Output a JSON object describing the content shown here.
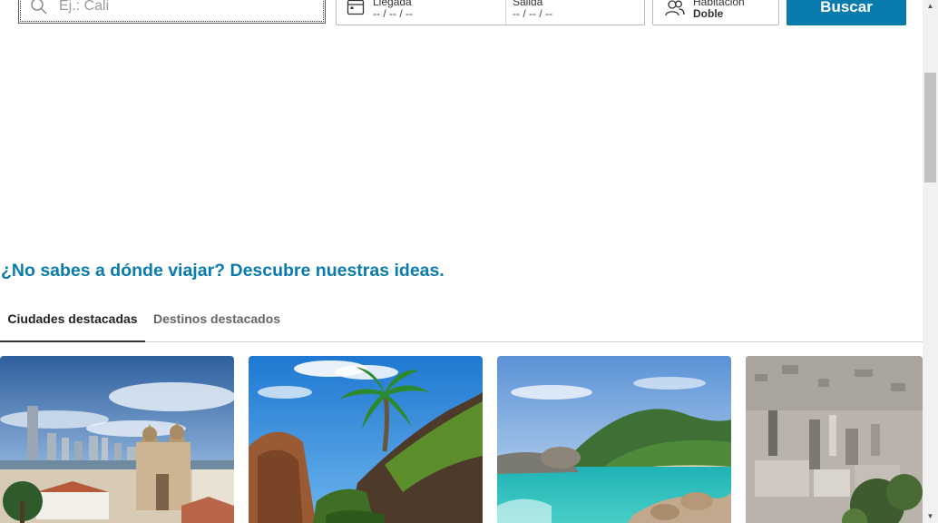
{
  "search": {
    "destination_placeholder": "Ej.: Cali",
    "destination_value": "",
    "arrival_label": "Llegada",
    "arrival_value": "-- / -- / --",
    "departure_label": "Salida",
    "departure_value": "-- / -- / --",
    "room_label": "Habitación",
    "room_value": "Doble",
    "search_button_label": "Buscar"
  },
  "ideas": {
    "title": "¿No sabes a dónde viajar? Descubre nuestras ideas.",
    "tabs": [
      {
        "label": "Ciudades destacadas",
        "active": true
      },
      {
        "label": "Destinos destacados",
        "active": false
      }
    ]
  },
  "colors": {
    "brand_blue": "#0a7bad",
    "active_tab_underline": "#333333"
  },
  "icons": {
    "search": "search-icon",
    "calendar": "calendar-icon",
    "guests": "guests-icon"
  }
}
